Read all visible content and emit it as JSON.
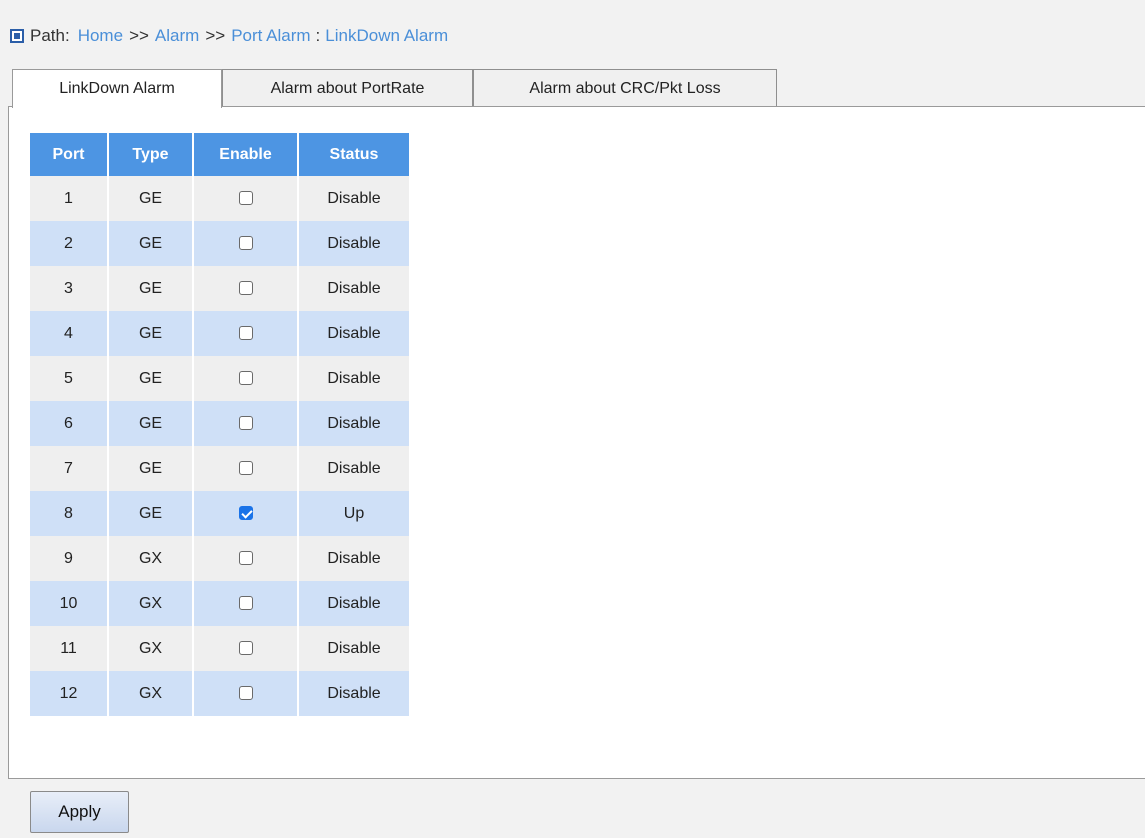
{
  "breadcrumb": {
    "label": "Path:",
    "home": "Home",
    "sep1": ">>",
    "alarm": "Alarm",
    "sep2": ">>",
    "port_alarm": "Port Alarm",
    "colon": ":",
    "current": "LinkDown Alarm"
  },
  "tabs": [
    {
      "label": "LinkDown Alarm",
      "active": true
    },
    {
      "label": "Alarm about PortRate",
      "active": false
    },
    {
      "label": "Alarm about CRC/Pkt Loss",
      "active": false
    }
  ],
  "table": {
    "headers": [
      "Port",
      "Type",
      "Enable",
      "Status"
    ],
    "rows": [
      {
        "port": "1",
        "type": "GE",
        "enabled": false,
        "status": "Disable"
      },
      {
        "port": "2",
        "type": "GE",
        "enabled": false,
        "status": "Disable"
      },
      {
        "port": "3",
        "type": "GE",
        "enabled": false,
        "status": "Disable"
      },
      {
        "port": "4",
        "type": "GE",
        "enabled": false,
        "status": "Disable"
      },
      {
        "port": "5",
        "type": "GE",
        "enabled": false,
        "status": "Disable"
      },
      {
        "port": "6",
        "type": "GE",
        "enabled": false,
        "status": "Disable"
      },
      {
        "port": "7",
        "type": "GE",
        "enabled": false,
        "status": "Disable"
      },
      {
        "port": "8",
        "type": "GE",
        "enabled": true,
        "status": "Up"
      },
      {
        "port": "9",
        "type": "GX",
        "enabled": false,
        "status": "Disable"
      },
      {
        "port": "10",
        "type": "GX",
        "enabled": false,
        "status": "Disable"
      },
      {
        "port": "11",
        "type": "GX",
        "enabled": false,
        "status": "Disable"
      },
      {
        "port": "12",
        "type": "GX",
        "enabled": false,
        "status": "Disable"
      }
    ]
  },
  "apply_label": "Apply",
  "colors": {
    "header_blue": "#4d95e3",
    "row_alt_blue": "#cfe0f7",
    "link_blue": "#4a8fd8",
    "checkbox_checked": "#1a73e8"
  }
}
